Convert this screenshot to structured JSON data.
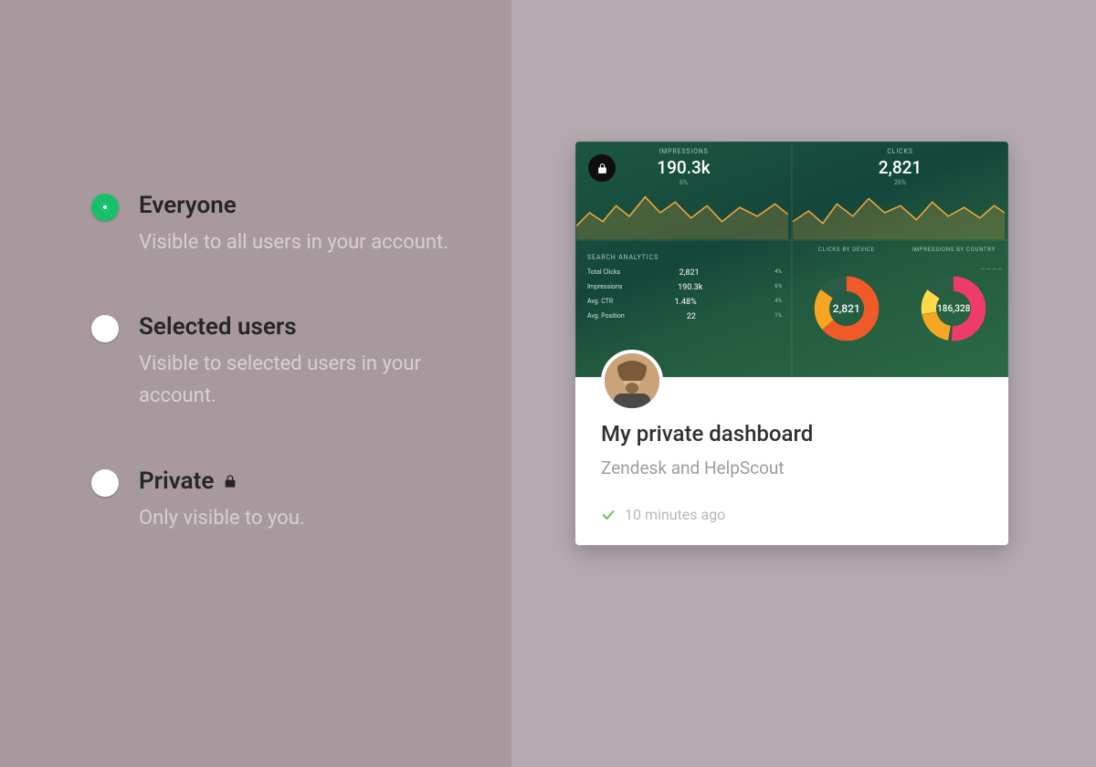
{
  "options": [
    {
      "title": "Everyone",
      "desc": "Visible to all users in your account.",
      "selected": true,
      "icon": null
    },
    {
      "title": "Selected users",
      "desc": "Visible to selected users in your account.",
      "selected": false,
      "icon": null
    },
    {
      "title": "Private",
      "desc": "Only visible to you.",
      "selected": false,
      "icon": "lock"
    }
  ],
  "card": {
    "title": "My private dashboard",
    "subtitle": "Zendesk and HelpScout",
    "timestamp": "10 minutes ago"
  },
  "thumb": {
    "impressions": {
      "label": "IMPRESSIONS",
      "value": "190.3k",
      "delta": "6%"
    },
    "clicks": {
      "label": "CLICKS",
      "value": "2,821",
      "delta": "26%"
    },
    "analytics": {
      "label": "SEARCH ANALYTICS",
      "rows": [
        {
          "k": "Total Clicks",
          "v": "2,821",
          "c": "4%"
        },
        {
          "k": "Impressions",
          "v": "190.3k",
          "c": "6%"
        },
        {
          "k": "Avg. CTR",
          "v": "1.48%",
          "c": "4%"
        },
        {
          "k": "Avg. Position",
          "v": "22",
          "c": "1%"
        }
      ]
    },
    "donut1": {
      "label": "CLICKS BY DEVICE",
      "center": "2,821"
    },
    "donut2": {
      "label": "IMPRESSIONS BY COUNTRY",
      "center": "186,328"
    }
  },
  "colors": {
    "accent": "#18c06a"
  }
}
